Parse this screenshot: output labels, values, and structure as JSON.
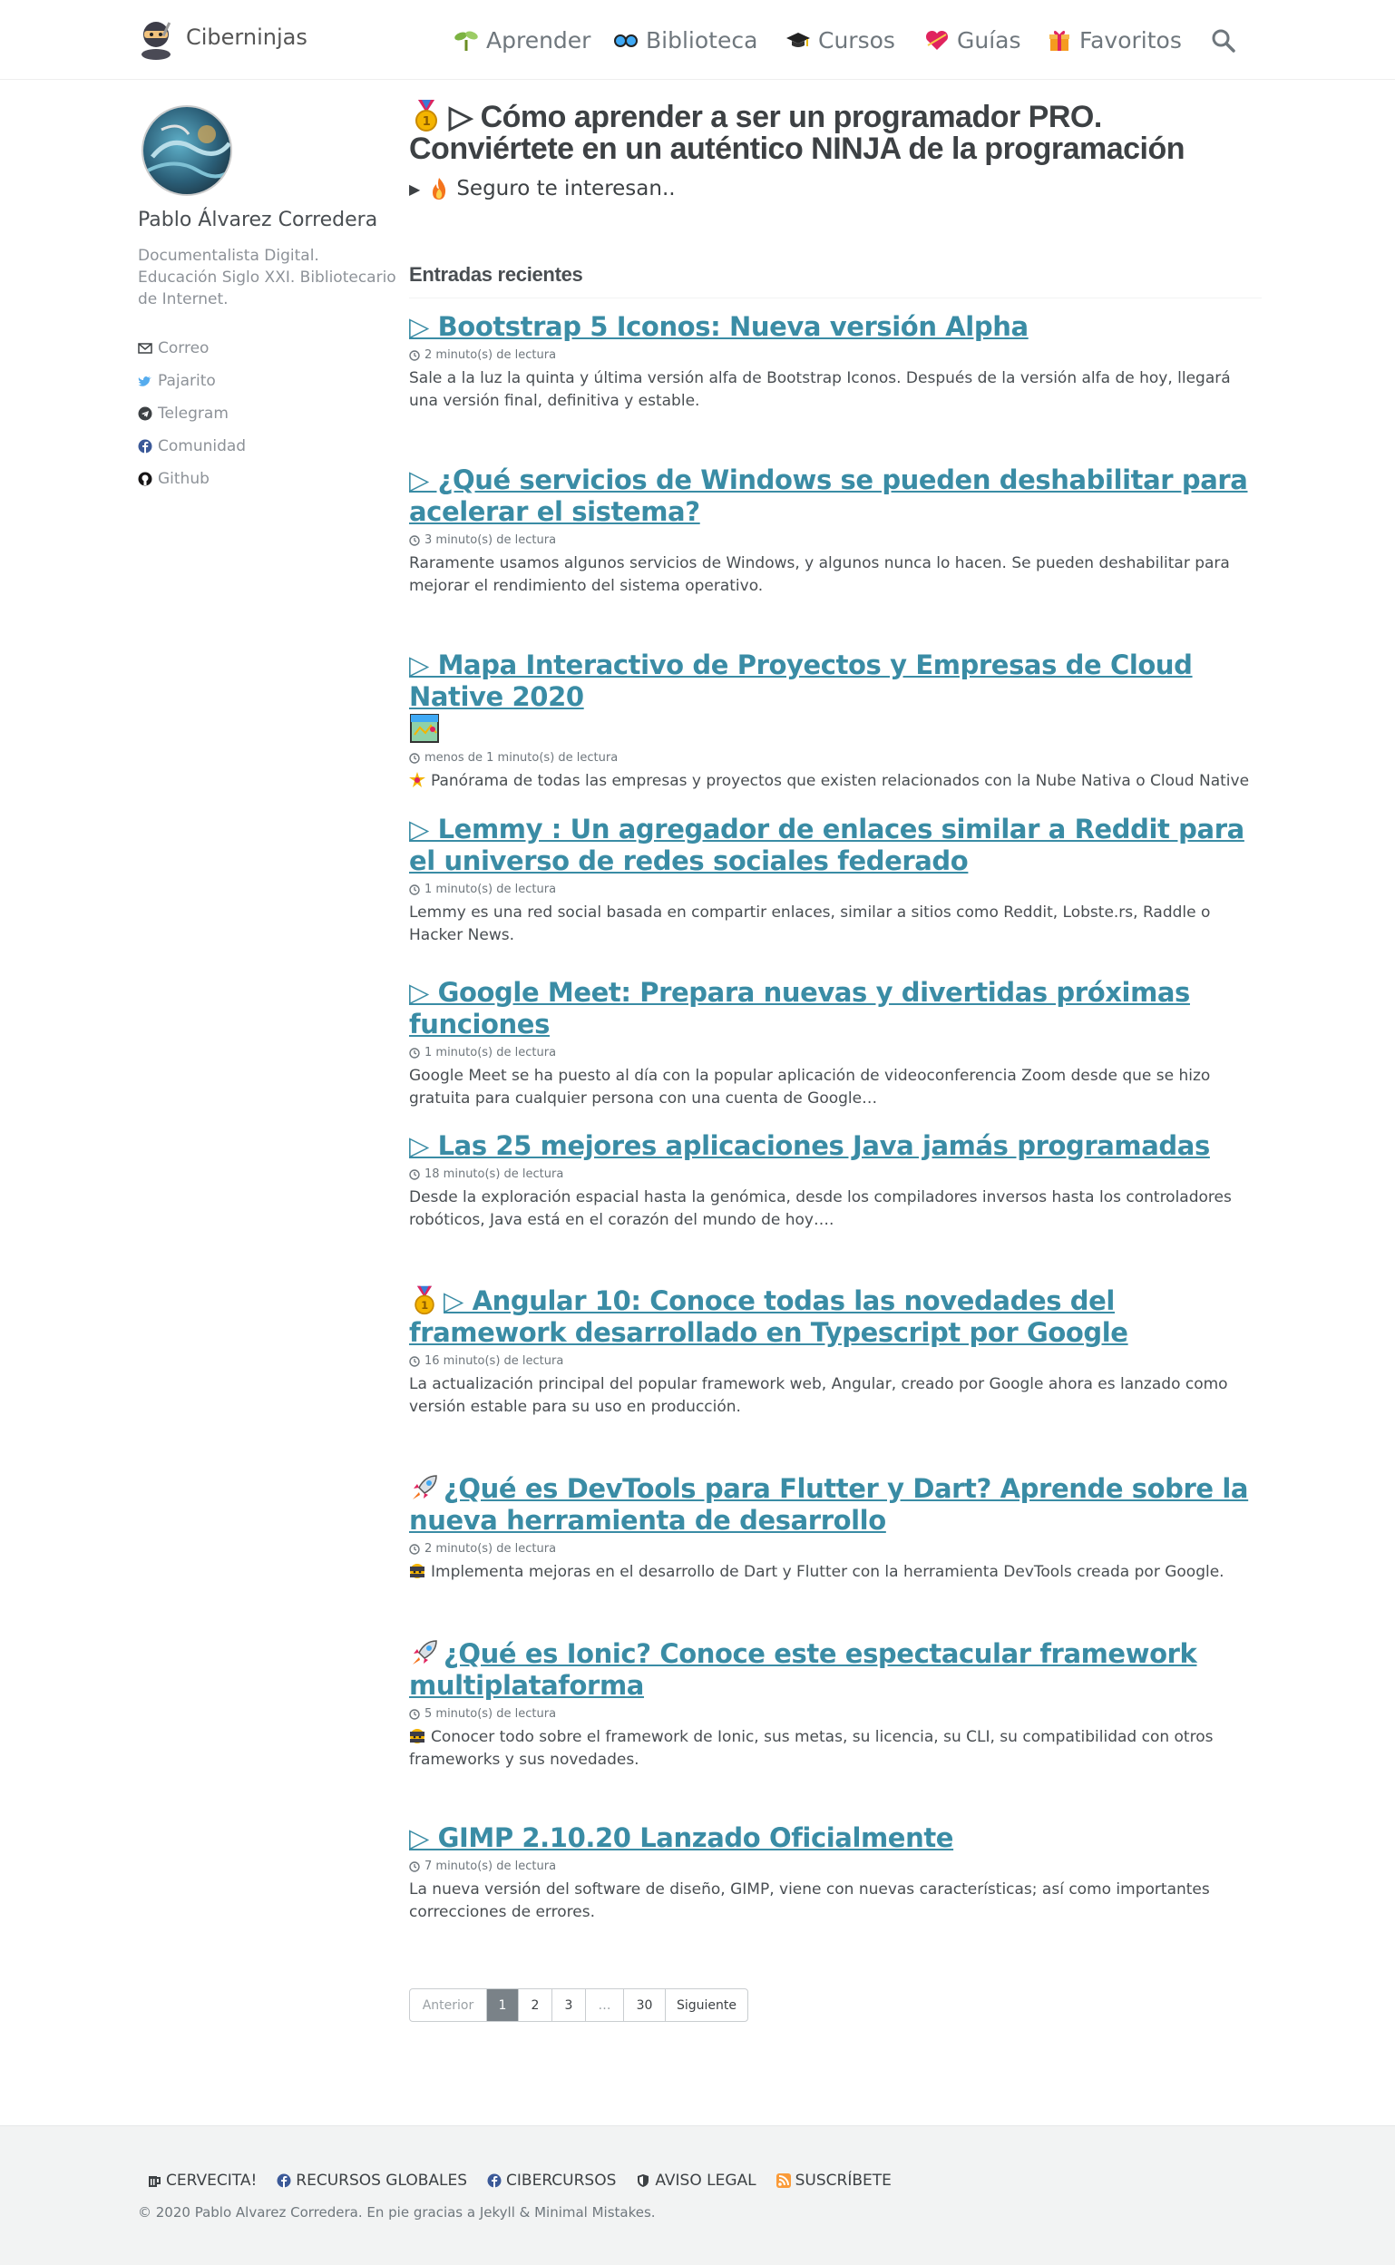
{
  "site": {
    "title": "Ciberninjas"
  },
  "nav": {
    "items": [
      {
        "label": "Aprender",
        "icon": "seedling-icon"
      },
      {
        "label": "Biblioteca",
        "icon": "glasses-icon"
      },
      {
        "label": "Cursos",
        "icon": "graduation-cap-icon"
      },
      {
        "label": "Guías",
        "icon": "heart-icon"
      },
      {
        "label": "Favoritos",
        "icon": "gift-icon"
      }
    ],
    "search_icon": "search-icon"
  },
  "author": {
    "name": "Pablo Álvarez Corredera",
    "bio": "Documentalista Digital. Educación Siglo XXI. Bibliotecario de Internet.",
    "links": [
      {
        "label": "Correo",
        "icon": "envelope-icon"
      },
      {
        "label": "Pajarito",
        "icon": "twitter-icon"
      },
      {
        "label": "Telegram",
        "icon": "telegram-icon"
      },
      {
        "label": "Comunidad",
        "icon": "facebook-icon"
      },
      {
        "label": "Github",
        "icon": "github-icon"
      }
    ]
  },
  "page": {
    "title": "▷ Cómo aprender a ser un programador PRO. Conviértete en un auténtico NINJA de la programación",
    "interest": "Seguro te interesan..",
    "recent_heading": "Entradas recientes"
  },
  "posts": [
    {
      "title": "▷ Bootstrap 5 Iconos: Nueva versión Alpha",
      "meta": "2 minuto(s) de lectura",
      "excerpt": "Sale a la luz la quinta y última versión alfa de Bootstrap Iconos. Después de la versión alfa de hoy, llegará una versión final, definitiva y estable."
    },
    {
      "title": "▷ ¿Qué servicios de Windows se pueden deshabilitar para acelerar el sistema?",
      "meta": "3 minuto(s) de lectura",
      "excerpt": "Raramente usamos algunos servicios de Windows, y algunos nunca lo hacen. Se pueden deshabilitar para mejorar el rendimiento del sistema operativo."
    },
    {
      "title": "▷ Mapa Interactivo de Proyectos y Empresas de Cloud Native 2020",
      "meta": "menos de 1 minuto(s) de lectura",
      "excerpt": "Panórama de todas las empresas y proyectos que existen relacionados con la Nube Nativa o Cloud Native"
    },
    {
      "title": "▷ Lemmy : Un agregador de enlaces similar a Reddit para el universo de redes sociales federado",
      "meta": "1 minuto(s) de lectura",
      "excerpt": "Lemmy es una red social basada en compartir enlaces, similar a sitios como Reddit, Lobste.rs, Raddle o Hacker News."
    },
    {
      "title": "▷ Google Meet: Prepara nuevas y divertidas próximas funciones",
      "meta": "1 minuto(s) de lectura",
      "excerpt": "Google Meet se ha puesto al día con la popular aplicación de videoconferencia Zoom desde que se hizo gratuita para cualquier persona con una cuenta de Google…"
    },
    {
      "title": "▷ Las 25 mejores aplicaciones Java jamás programadas",
      "meta": "18 minuto(s) de lectura",
      "excerpt": "Desde la exploración espacial hasta la genómica, desde los compiladores inversos hasta los controladores robóticos, Java está en el corazón del mundo de hoy…."
    },
    {
      "title": "▷ Angular 10: Conoce todas las novedades del framework desarrollado en Typescript por Google",
      "meta": "16 minuto(s) de lectura",
      "excerpt": "La actualización principal del popular framework web, Angular, creado por Google ahora es lanzado como versión estable para su uso en producción."
    },
    {
      "title": "¿Qué es DevTools para Flutter y Dart? Aprende sobre la nueva herramienta de desarrollo",
      "meta": "2 minuto(s) de lectura",
      "excerpt": "Implementa mejoras en el desarrollo de Dart y Flutter con la herramienta DevTools creada por Google."
    },
    {
      "title": "¿Qué es Ionic? Conoce este espectacular framework multiplataforma",
      "meta": "5 minuto(s) de lectura",
      "excerpt": "Conocer todo sobre el framework de Ionic, sus metas, su licencia, su CLI, su compatibilidad con otros frameworks y sus novedades."
    },
    {
      "title": "▷ GIMP 2.10.20 Lanzado Oficialmente",
      "meta": "7 minuto(s) de lectura",
      "excerpt": "La nueva versión del software de diseño, GIMP, viene con nuevas características; así como importantes correcciones de errores."
    }
  ],
  "pagination": {
    "prev": "Anterior",
    "pages": [
      "1",
      "2",
      "3",
      "…",
      "30"
    ],
    "next": "Siguiente"
  },
  "footer": {
    "links": [
      {
        "label": "CERVECITA!",
        "icon": "beer-icon"
      },
      {
        "label": "RECURSOS GLOBALES",
        "icon": "facebook-icon"
      },
      {
        "label": "CIBERCURSOS",
        "icon": "facebook-icon"
      },
      {
        "label": "AVISO LEGAL",
        "icon": "shield-icon"
      },
      {
        "label": "SUSCRÍBETE",
        "icon": "rss-icon"
      }
    ],
    "copyright": "© 2020 Pablo Alvarez Corredera. En pie gracias a Jekyll & Minimal Mistakes."
  },
  "colors": {
    "link": "#3a8ca5",
    "text": "#494e52",
    "footer_bg": "#f2f3f3",
    "pagination_current": "#7a8288"
  }
}
